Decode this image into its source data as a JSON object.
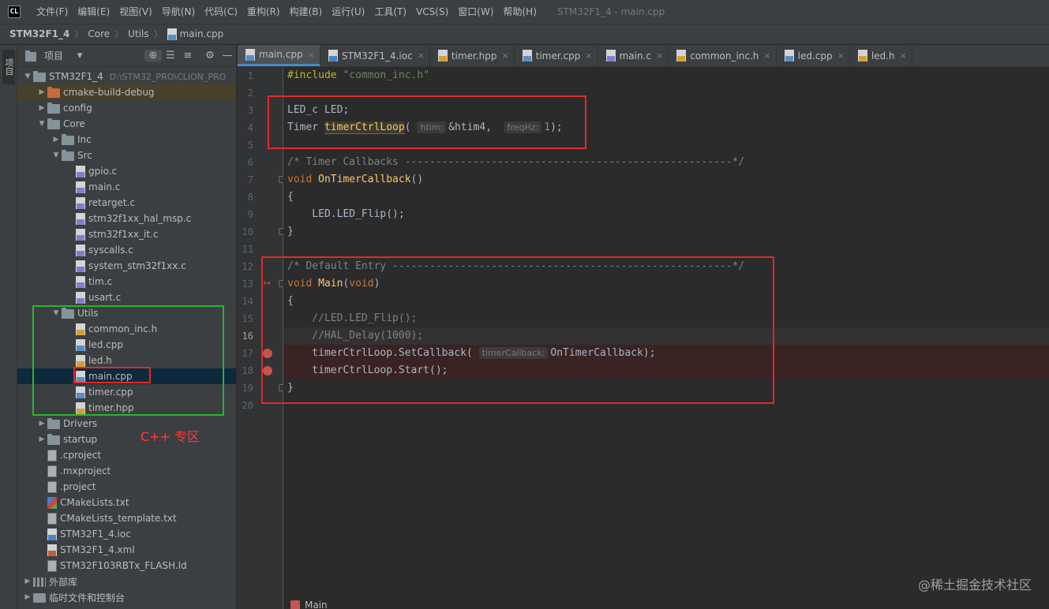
{
  "app": {
    "logo_text": "CL",
    "menu": [
      "文件(F)",
      "编辑(E)",
      "视图(V)",
      "导航(N)",
      "代码(C)",
      "重构(R)",
      "构建(B)",
      "运行(U)",
      "工具(T)",
      "VCS(S)",
      "窗口(W)",
      "帮助(H)"
    ],
    "window_title": "STM32F1_4 - main.cpp"
  },
  "breadcrumb": [
    "STM32F1_4",
    "Core",
    "Utils",
    "main.cpp"
  ],
  "tool_strip": {
    "project_label": "项目"
  },
  "project_panel": {
    "title": "项目",
    "tree": [
      {
        "label": "STM32F1_4",
        "hint": "D:\\STM32_PRO\\CLION_PRO",
        "icon": "folder",
        "arrow": "open"
      },
      {
        "label": "cmake-build-debug",
        "icon": "folder-orange",
        "arrow": "closed"
      },
      {
        "label": "config",
        "icon": "folder",
        "arrow": "closed"
      },
      {
        "label": "Core",
        "icon": "folder",
        "arrow": "open"
      },
      {
        "label": "Inc",
        "icon": "folder",
        "arrow": "closed"
      },
      {
        "label": "Src",
        "icon": "folder",
        "arrow": "open"
      },
      {
        "label": "gpio.c",
        "icon": "c"
      },
      {
        "label": "main.c",
        "icon": "c"
      },
      {
        "label": "retarget.c",
        "icon": "c"
      },
      {
        "label": "stm32f1xx_hal_msp.c",
        "icon": "c"
      },
      {
        "label": "stm32f1xx_it.c",
        "icon": "c"
      },
      {
        "label": "syscalls.c",
        "icon": "c"
      },
      {
        "label": "system_stm32f1xx.c",
        "icon": "c"
      },
      {
        "label": "tim.c",
        "icon": "c"
      },
      {
        "label": "usart.c",
        "icon": "c"
      },
      {
        "label": "Utils",
        "icon": "folder",
        "arrow": "open"
      },
      {
        "label": "common_inc.h",
        "icon": "h"
      },
      {
        "label": "led.cpp",
        "icon": "cpp"
      },
      {
        "label": "led.h",
        "icon": "h"
      },
      {
        "label": "main.cpp",
        "icon": "cpp",
        "selected": true
      },
      {
        "label": "timer.cpp",
        "icon": "cpp"
      },
      {
        "label": "timer.hpp",
        "icon": "h"
      },
      {
        "label": "Drivers",
        "icon": "folder",
        "arrow": "closed"
      },
      {
        "label": "startup",
        "icon": "folder",
        "arrow": "closed"
      },
      {
        "label": ".cproject",
        "icon": "doc"
      },
      {
        "label": ".mxproject",
        "icon": "doc"
      },
      {
        "label": ".project",
        "icon": "doc"
      },
      {
        "label": "CMakeLists.txt",
        "icon": "cmake"
      },
      {
        "label": "CMakeLists_template.txt",
        "icon": "doc"
      },
      {
        "label": "STM32F1_4.ioc",
        "icon": "ioc"
      },
      {
        "label": "STM32F1_4.xml",
        "icon": "xml"
      },
      {
        "label": "STM32F103RBTx_FLASH.ld",
        "icon": "doc"
      },
      {
        "label": "外部库",
        "icon": "lib",
        "arrow": "closed"
      },
      {
        "label": "临时文件和控制台",
        "icon": "scratch",
        "arrow": "closed"
      }
    ],
    "annotation": "C++ 专区"
  },
  "tabs": [
    {
      "label": "main.cpp",
      "icon": "cpp",
      "active": true
    },
    {
      "label": "STM32F1_4.ioc",
      "icon": "ioc"
    },
    {
      "label": "timer.hpp",
      "icon": "h"
    },
    {
      "label": "timer.cpp",
      "icon": "cpp"
    },
    {
      "label": "main.c",
      "icon": "c"
    },
    {
      "label": "common_inc.h",
      "icon": "h"
    },
    {
      "label": "led.cpp",
      "icon": "cpp"
    },
    {
      "label": "led.h",
      "icon": "h"
    }
  ],
  "editor": {
    "current_line": 16,
    "breakpoints": [
      17,
      18
    ],
    "lines": [
      [
        [
          "pp",
          "#include "
        ],
        [
          "str",
          "\"common_inc.h\""
        ]
      ],
      [],
      [
        [
          "cls",
          "LED_c LED;"
        ]
      ],
      [
        [
          "cls",
          "Timer "
        ],
        [
          "hl",
          "timerCtrlLoop"
        ],
        [
          "cls",
          "( "
        ],
        [
          "inlay",
          "htim:"
        ],
        [
          "cls",
          "&htim4,  "
        ],
        [
          "inlay",
          "freqHz:"
        ],
        [
          "num",
          "1"
        ],
        [
          "cls",
          ");"
        ]
      ],
      [],
      [
        [
          "cm",
          "/* Timer Callbacks -----------------------------------------------------*/"
        ]
      ],
      [
        [
          "kw",
          "void "
        ],
        [
          "fn",
          "OnTimerCallback"
        ],
        [
          "cls",
          "()"
        ]
      ],
      [
        [
          "cls",
          "{"
        ]
      ],
      [
        [
          "cls",
          "    LED.LED_Flip();"
        ]
      ],
      [
        [
          "cls",
          "}"
        ]
      ],
      [],
      [
        [
          "cm",
          "/* Default Entry -------------------------------------------------------*/"
        ]
      ],
      [
        [
          "kw",
          "void "
        ],
        [
          "fn",
          "Main"
        ],
        [
          "cls",
          "("
        ],
        [
          "kw",
          "void"
        ],
        [
          "cls",
          ")"
        ]
      ],
      [
        [
          "cls",
          "{"
        ]
      ],
      [
        [
          "cm",
          "    //LED.LED_Flip();"
        ]
      ],
      [
        [
          "cm",
          "    //HAL_Delay(1000);"
        ]
      ],
      [
        [
          "cls",
          "    timerCtrlLoop.SetCallback( "
        ],
        [
          "inlay",
          "timerCallback:"
        ],
        [
          "cls",
          "OnTimerCallback);"
        ]
      ],
      [
        [
          "cls",
          "    timerCtrlLoop.Start();"
        ]
      ],
      [
        [
          "cls",
          "}"
        ]
      ],
      []
    ]
  },
  "bottom_crumb": "Main",
  "watermark": "@稀土掘金技术社区"
}
